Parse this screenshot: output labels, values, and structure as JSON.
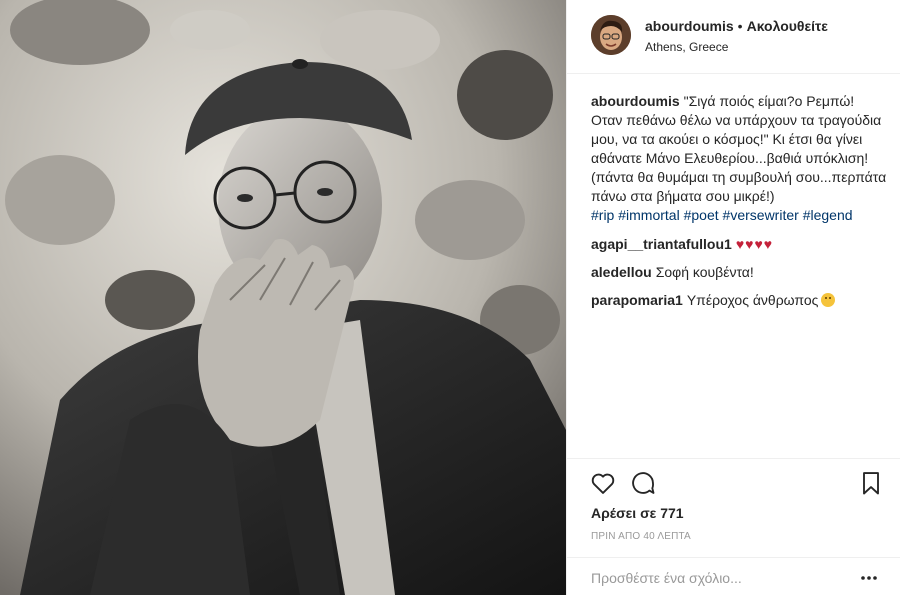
{
  "post": {
    "username": "abourdoumis",
    "separator": "•",
    "follow_label": "Ακολουθείτε",
    "location": "Athens, Greece"
  },
  "caption": {
    "username": "abourdoumis",
    "text": "\"Σιγά ποιός είμαι?ο Ρεμπώ! Οταν πεθάνω θέλω να υπάρχουν τα τραγούδια μου, να τα ακούει ο κόσμος!\" Κι έτσι θα γίνει αθάνατε Μάνο Ελευθερίου...βαθιά υπόκλιση!(πάντα θα θυμάμαι τη συμβουλή σου...περπάτα πάνω στα βήματα σου μικρέ!)",
    "hashtags": [
      "#rip",
      "#immortal",
      "#poet",
      "#versewriter",
      "#legend"
    ]
  },
  "comments": [
    {
      "username": "agapi__triantafullou1",
      "text": "♥♥♥♥"
    },
    {
      "username": "aledellou",
      "text": "Σοφή κουβέντα!"
    },
    {
      "username": "parapomaria1",
      "text": "Υπέροχος άνθρωπος",
      "emoji": "hushed-face-emoji"
    }
  ],
  "actions": {
    "icons": [
      "heart-icon",
      "comment-bubble-icon",
      "bookmark-icon"
    ],
    "likes_text": "Αρέσει σε 771",
    "timestamp": "ΠΡΙΝ ΑΠΟ 40 ΛΕΠΤΑ"
  },
  "add_comment": {
    "placeholder": "Προσθέστε ένα σχόλιο...",
    "more_icon": "more-options-icon"
  },
  "colors": {
    "hashtag": "#003569",
    "hearts": "#c4213a",
    "border": "#efefef",
    "muted": "#999999"
  }
}
